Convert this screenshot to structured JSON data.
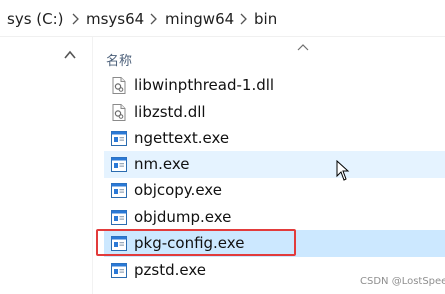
{
  "breadcrumb": {
    "items": [
      "sys (C:)",
      "msys64",
      "mingw64",
      "bin"
    ]
  },
  "column_header": {
    "name_label": "名称"
  },
  "files": [
    {
      "name": "libwinpthread-1.dll",
      "type": "dll",
      "state": "normal"
    },
    {
      "name": "libzstd.dll",
      "type": "dll",
      "state": "normal"
    },
    {
      "name": "ngettext.exe",
      "type": "exe",
      "state": "normal"
    },
    {
      "name": "nm.exe",
      "type": "exe",
      "state": "hover"
    },
    {
      "name": "objcopy.exe",
      "type": "exe",
      "state": "normal"
    },
    {
      "name": "objdump.exe",
      "type": "exe",
      "state": "normal"
    },
    {
      "name": "pkg-config.exe",
      "type": "exe",
      "state": "selected"
    },
    {
      "name": "pzstd.exe",
      "type": "exe",
      "state": "normal"
    }
  ],
  "watermark": "CSDN @LostSpeed",
  "colors": {
    "hover_bg": "#e5f3ff",
    "selected_bg": "#cce8ff",
    "highlight_box": "#e23b3b"
  }
}
